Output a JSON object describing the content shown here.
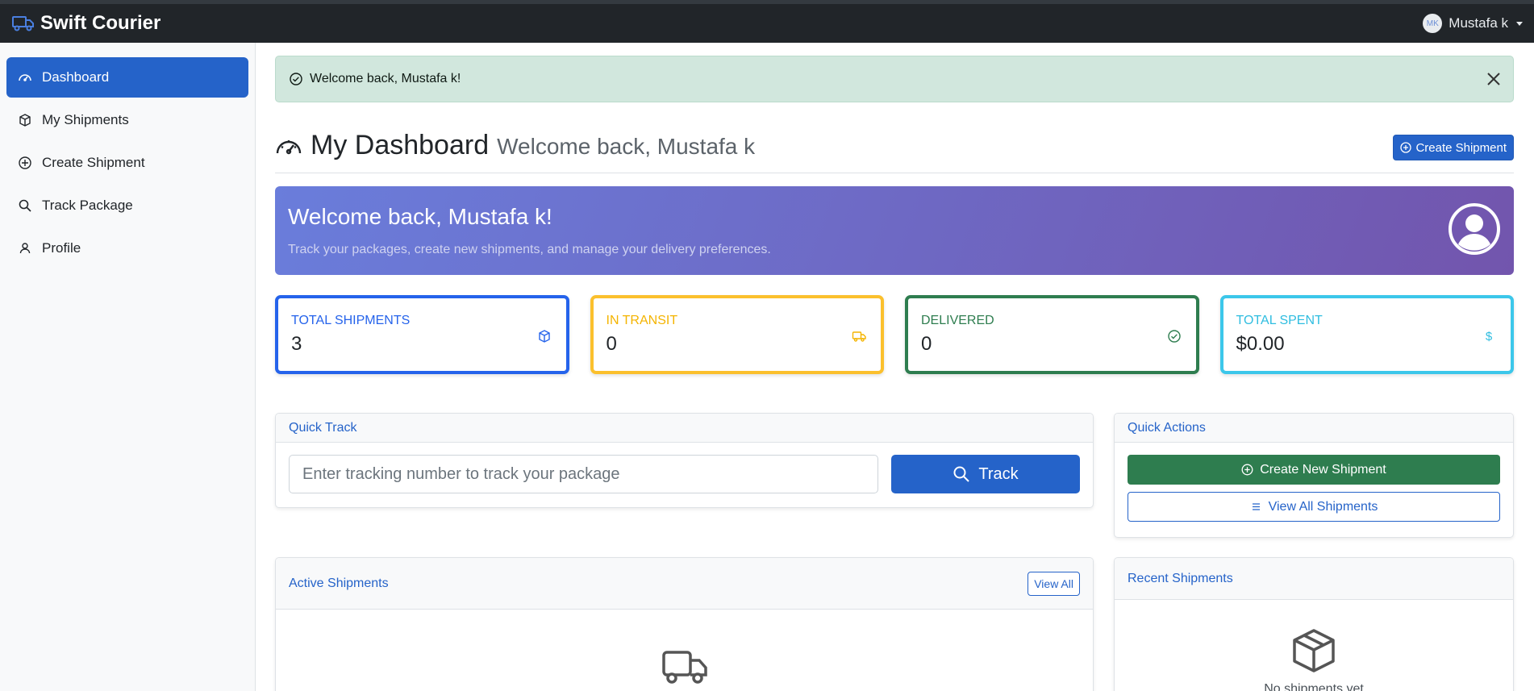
{
  "app": {
    "brand": "Swift Courier",
    "brand_color": "#2563c9"
  },
  "user": {
    "initials": "MK",
    "name": "Mustafa k"
  },
  "sidebar": {
    "items": [
      {
        "label": "Dashboard",
        "icon": "gauge-icon",
        "active": true
      },
      {
        "label": "My Shipments",
        "icon": "box-icon"
      },
      {
        "label": "Create Shipment",
        "icon": "plus-circle-icon"
      },
      {
        "label": "Track Package",
        "icon": "search-icon"
      },
      {
        "label": "Profile",
        "icon": "person-icon"
      }
    ]
  },
  "alert": {
    "message": "Welcome back, Mustafa k!"
  },
  "header": {
    "title": "My Dashboard",
    "subtitle": "Welcome back, Mustafa k",
    "create_button": "Create Shipment"
  },
  "banner": {
    "title": "Welcome back, Mustafa k!",
    "text": "Track your packages, create new shipments, and manage your delivery preferences."
  },
  "stats": [
    {
      "label": "TOTAL SHIPMENTS",
      "value": "3",
      "color": "#2563eb",
      "icon": "box-icon"
    },
    {
      "label": "IN TRANSIT",
      "value": "0",
      "color": "#fbc02d",
      "icon": "truck-icon"
    },
    {
      "label": "DELIVERED",
      "value": "0",
      "color": "#2e7d4f",
      "icon": "check-circle-icon"
    },
    {
      "label": "TOTAL SPENT",
      "value": "$0.00",
      "color": "#3cc7ea",
      "icon": "dollar-icon"
    }
  ],
  "quick_track": {
    "title": "Quick Track",
    "placeholder": "Enter tracking number to track your package",
    "button": "Track"
  },
  "quick_actions": {
    "title": "Quick Actions",
    "create_new": "Create New Shipment",
    "view_all": "View All Shipments"
  },
  "active_shipments": {
    "title": "Active Shipments",
    "view_all": "View All"
  },
  "recent_shipments": {
    "title": "Recent Shipments",
    "empty_text": "No shipments yet"
  }
}
